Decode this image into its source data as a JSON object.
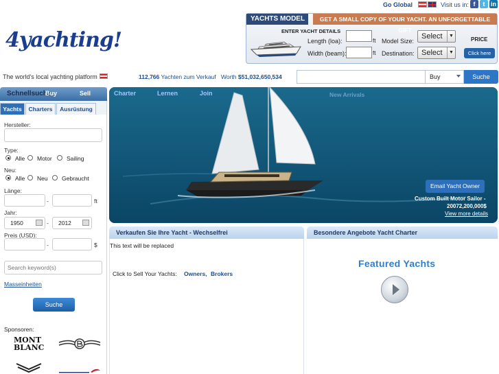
{
  "topbar": {
    "go_global": "Go Global",
    "visit_us": "Visit us in:"
  },
  "social": {
    "facebook": "f",
    "twitter": "t",
    "linkedin": "in"
  },
  "logo": {
    "text": "4yachting!"
  },
  "tagline": "The world's local yachting platform",
  "model_widget": {
    "title": "YACHTS MODEL",
    "banner": "GET A SMALL COPY OF YOUR YACHT. AN UNFORGETTABLE GIFT",
    "enter_details": "ENTER YACHT DETAILS",
    "length_label": "Length (loa):",
    "width_label": "Width (beam):",
    "unit": "ft",
    "size_label": "Model Size:",
    "destination_label": "Destination:",
    "select_value": "Select",
    "price_label": "PRICE",
    "click_here": "Click here"
  },
  "stats": {
    "count": "112,766",
    "count_suffix": "Yachten zum Verkauf",
    "worth_prefix": "Worth",
    "worth": "$51,032,650,534"
  },
  "search": {
    "type": "Buy",
    "button": "Suche"
  },
  "sidebar": {
    "title": "Schnellsuche",
    "nav_buy": "Buy",
    "nav_sell": "Sell",
    "tabs": [
      "Yachts",
      "Charters",
      "Ausrüstung"
    ],
    "manufacturer_label": "Hersteller:",
    "type_label": "Type:",
    "type_options": [
      "Alle",
      "Motor",
      "Sailing"
    ],
    "new_label": "Neu:",
    "new_options": [
      "Alle",
      "Neu",
      "Gebraucht"
    ],
    "length_label": "Länge:",
    "length_unit": "ft",
    "year_label": "Jahr:",
    "year_from": "1950",
    "year_to": "2012",
    "price_label": "Preis (USD):",
    "price_unit": "$",
    "dash": "-",
    "keyword_placeholder": "Search keyword(s)",
    "units_link": "Masseinheiten",
    "search_button": "Suche",
    "sponsors_label": "Sponsoren:",
    "montblanc_line1": "MONT",
    "montblanc_line2": "BLANC"
  },
  "hero": {
    "nav_charter": "Charter",
    "nav_learn": "Lernen",
    "nav_join": "Join",
    "nav_new": "New Arrivals",
    "email_owner": "Email Yacht Owner",
    "caption": "Custom Built Motor Sailor -",
    "price": "20072,200,000$",
    "more": "View more details"
  },
  "sell_panel": {
    "title": "Verkaufen Sie Ihre Yacht - Wechselfrei",
    "placeholder_text": "This text will be replaced",
    "line": "Click to Sell Your Yachts:",
    "owners": "Owners,",
    "brokers": "Brokers"
  },
  "offers_panel": {
    "title": "Besondere Angebote Yacht Charter",
    "featured": "Featured Yachts"
  }
}
